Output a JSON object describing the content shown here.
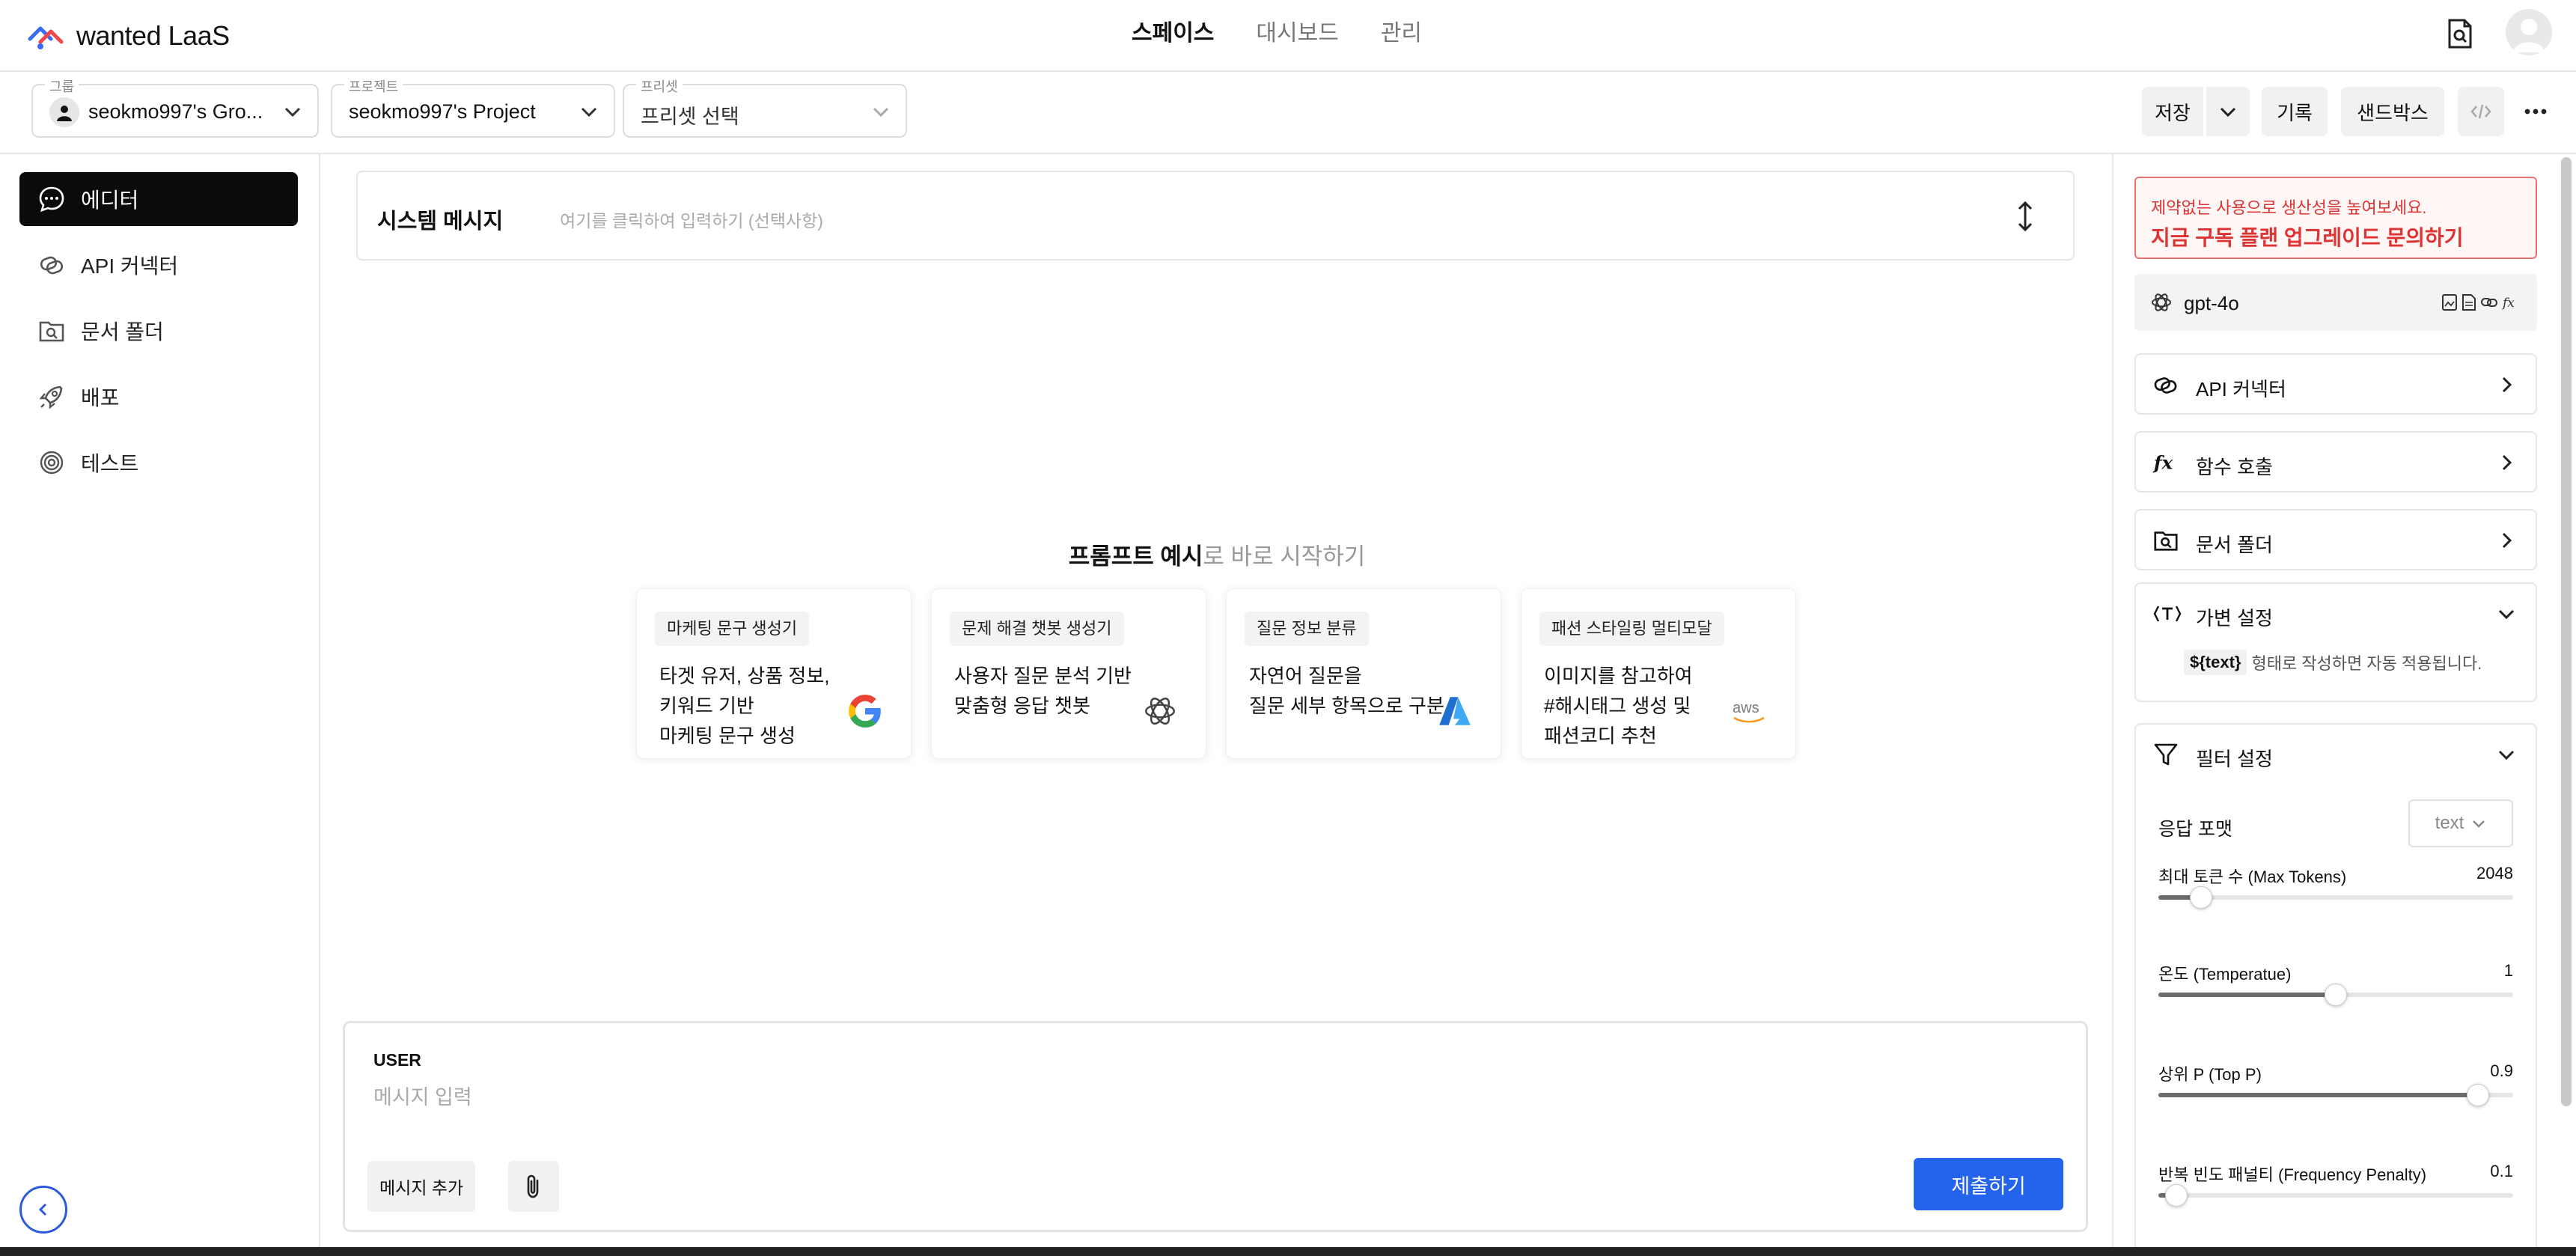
{
  "app": {
    "brand": "wanted LaaS"
  },
  "topnav": {
    "tabs": [
      {
        "label": "스페이스",
        "active": true
      },
      {
        "label": "대시보드",
        "active": false
      },
      {
        "label": "관리",
        "active": false
      }
    ]
  },
  "toolbar": {
    "group": {
      "label": "그룹",
      "value": "seokmo997's Gro..."
    },
    "project": {
      "label": "프로젝트",
      "value": "seokmo997's Project"
    },
    "preset": {
      "label": "프리셋",
      "value": "프리셋 선택"
    },
    "save_label": "저장",
    "history_label": "기록",
    "sandbox_label": "샌드박스"
  },
  "sidebar": {
    "items": [
      {
        "label": "에디터",
        "active": true
      },
      {
        "label": "API 커넥터",
        "active": false
      },
      {
        "label": "문서 폴더",
        "active": false
      },
      {
        "label": "배포",
        "active": false
      },
      {
        "label": "테스트",
        "active": false
      }
    ]
  },
  "main": {
    "system": {
      "title": "시스템 메시지",
      "placeholder": "여기를 클릭하여 입력하기 (선택사항)"
    },
    "examples_title_bold": "프롬프트 예시",
    "examples_title_rest": "로 바로 시작하기",
    "cards": [
      {
        "tag": "마케팅 문구 생성기",
        "desc": "타겟 유저, 상품 정보,\n키워드 기반\n마케팅 문구 생성",
        "brand": "google-icon"
      },
      {
        "tag": "문제 해결 챗봇 생성기",
        "desc": "사용자 질문 분석 기반\n맞춤형 응답 챗봇",
        "brand": "openai-icon"
      },
      {
        "tag": "질문 정보 분류",
        "desc": "자연어 질문을\n질문 세부 항목으로 구분",
        "brand": "azure-icon"
      },
      {
        "tag": "패션 스타일링 멀티모달",
        "desc": "이미지를 참고하여\n#해시태그 생성 및\n패션코디 추천",
        "brand": "aws-icon"
      }
    ],
    "user": {
      "role": "USER",
      "placeholder": "메시지 입력",
      "add_label": "메시지 추가",
      "submit_label": "제출하기"
    }
  },
  "rpanel": {
    "promo": {
      "line1": "제약없는 사용으로 생산성을 높여보세요.",
      "line2": "지금 구독 플랜 업그레이드 문의하기"
    },
    "model": "gpt-4o",
    "rows": [
      {
        "label": "API 커넥터",
        "icon": "link-icon"
      },
      {
        "label": "함수 호출",
        "icon": "function-icon"
      },
      {
        "label": "문서 폴더",
        "icon": "folder-search-icon"
      }
    ],
    "variable": {
      "title": "가변 설정",
      "code": "${text}",
      "hint": "형태로 작성하면 자동 적용됩니다."
    },
    "filter": {
      "title": "필터 설정",
      "format_label": "응답 포맷",
      "format_value": "text",
      "sliders": [
        {
          "label": "최대 토큰 수 (Max Tokens)",
          "value": "2048",
          "fraction": 0.12
        },
        {
          "label": "온도 (Temperatue)",
          "value": "1",
          "fraction": 0.5
        },
        {
          "label": "상위 P (Top P)",
          "value": "0.9",
          "fraction": 0.9
        },
        {
          "label": "반복 빈도 패널티 (Frequency Penalty)",
          "value": "0.1",
          "fraction": 0.05
        }
      ]
    }
  },
  "colors": {
    "accent": "#2463eb",
    "promo": "#dd3333"
  }
}
